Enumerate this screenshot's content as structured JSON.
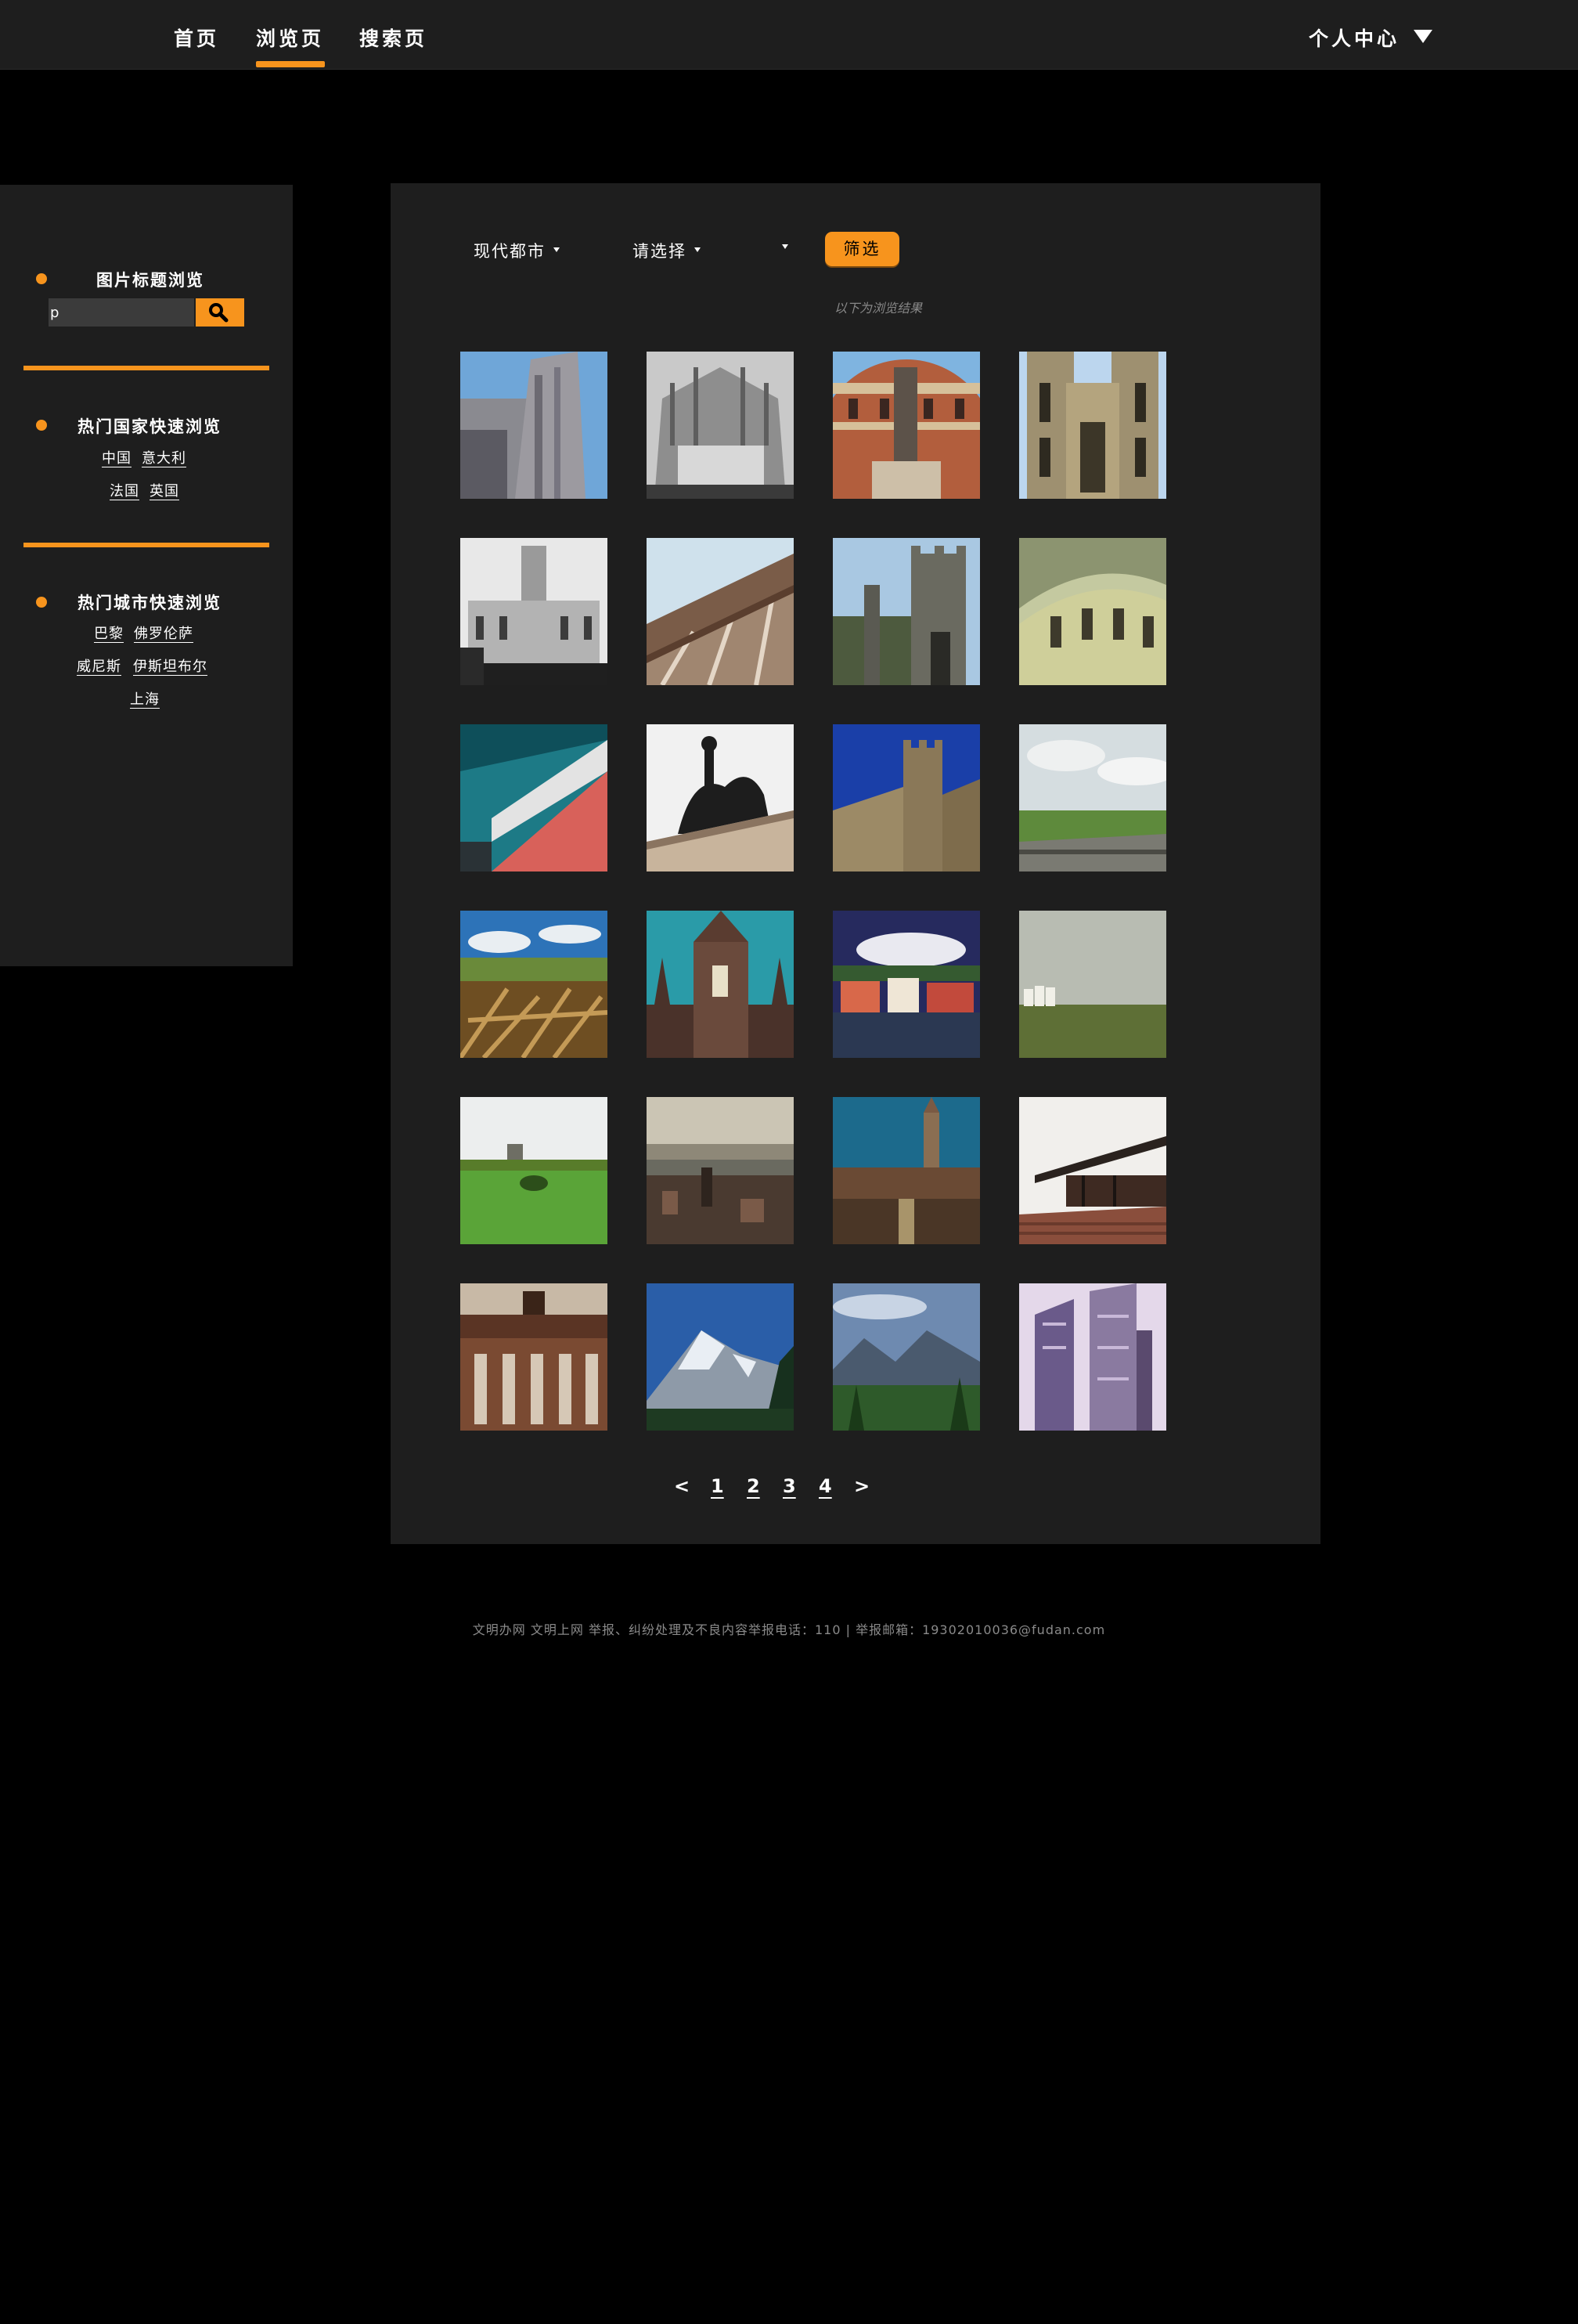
{
  "nav": {
    "home": "首页",
    "browse": "浏览页",
    "search": "搜索页",
    "user_center": "个人中心"
  },
  "sidebar": {
    "title_browse": {
      "heading": "图片标题浏览",
      "search_value": "p"
    },
    "hot_countries": {
      "heading": "热门国家快速浏览",
      "items": [
        "中国",
        "意大利",
        "法国",
        "英国"
      ]
    },
    "hot_cities": {
      "heading": "热门城市快速浏览",
      "items": [
        "巴黎",
        "佛罗伦萨",
        "威尼斯",
        "伊斯坦布尔",
        "上海"
      ]
    }
  },
  "filters": {
    "theme_selected": "现代都市",
    "country_selected": "请选择",
    "city_selected": "",
    "filter_button": "筛选"
  },
  "results_note": "以下为浏览结果",
  "gallery": [
    {
      "subject": "cathedral-tower"
    },
    {
      "subject": "gothic-cathedral-bw"
    },
    {
      "subject": "royal-albert-hall"
    },
    {
      "subject": "gothic-abbey-facade"
    },
    {
      "subject": "white-palace"
    },
    {
      "subject": "stadium-santiago-bernabeu"
    },
    {
      "subject": "stone-castle-gate"
    },
    {
      "subject": "glass-dome-museum"
    },
    {
      "subject": "arsenal-stadium"
    },
    {
      "subject": "equestrian-statue"
    },
    {
      "subject": "castle-turret"
    },
    {
      "subject": "coastal-cliffs"
    },
    {
      "subject": "dry-branches-field"
    },
    {
      "subject": "church-spire"
    },
    {
      "subject": "harbour-town"
    },
    {
      "subject": "grassland-buildings"
    },
    {
      "subject": "green-meadow"
    },
    {
      "subject": "river-city-view"
    },
    {
      "subject": "old-town-church"
    },
    {
      "subject": "modern-pavilion"
    },
    {
      "subject": "brandenburg-gate"
    },
    {
      "subject": "snowy-mountain"
    },
    {
      "subject": "alpine-valley"
    },
    {
      "subject": "modern-towers"
    }
  ],
  "pagination": {
    "prev": "<",
    "pages": [
      "1",
      "2",
      "3",
      "4"
    ],
    "next": ">"
  },
  "footer": {
    "text": "文明办网 文明上网 举报、纠纷处理及不良内容举报电话：110 | 举报邮箱：19302010036@fudan.com"
  },
  "colors": {
    "accent": "#f7941d",
    "panel": "#1e1e1e",
    "background": "#000000"
  },
  "icons": {
    "search_button": "magnifier-icon",
    "user_dropdown": "caret-down-icon"
  }
}
